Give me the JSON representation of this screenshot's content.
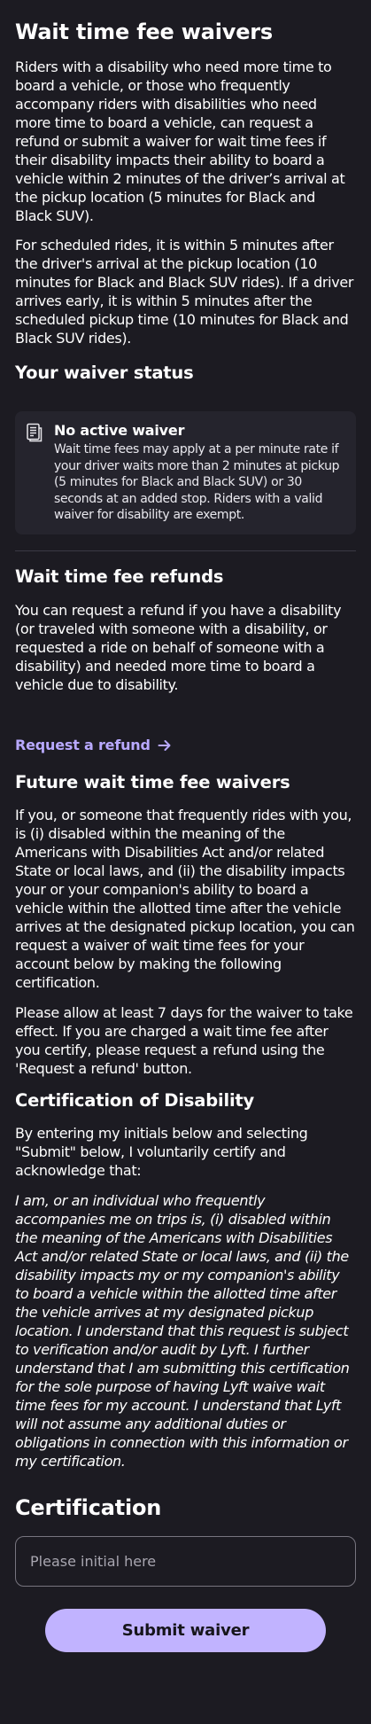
{
  "page_title": "Wait time fee waivers",
  "intro_paragraphs": [
    "Riders with a disability who need more time to board a vehicle, or those who frequently accompany riders with disabilities who need more time to board a vehicle, can request a refund or submit a waiver for wait time fees if their disability impacts their ability to board a vehicle within 2 minutes of the driver’s arrival at the pickup location (5 minutes for Black and Black SUV).",
    "For scheduled rides, it is within 5 minutes after the driver's arrival at the pickup location (10 minutes for Black and Black SUV rides). If a driver arrives early, it is within 5 minutes after the scheduled pickup time (10 minutes for Black and Black SUV rides)."
  ],
  "waiver_status": {
    "heading": "Your waiver status",
    "icon": "document-icon",
    "title": "No active waiver",
    "description": "Wait time fees may apply at a per minute rate if your driver waits more than 2 minutes at pickup (5 minutes for Black and Black SUV) or 30 seconds at an added stop. Riders with a valid waiver for disability are exempt."
  },
  "refunds": {
    "heading": "Wait time fee refunds",
    "text": "You can request a refund if you have a disability (or traveled with someone with a disability, or requested a ride on behalf of someone with a disability) and needed more time to board a vehicle due to disability.",
    "link_label": "Request a refund",
    "link_icon": "arrow-right-icon"
  },
  "future_waivers": {
    "heading": "Future wait time fee waivers",
    "paragraphs": [
      "If you, or someone that frequently rides with you, is (i) disabled within the meaning of the Americans with Disabilities Act and/or related State or local laws, and (ii) the disability impacts your or your companion's ability to board a vehicle within the allotted time after the vehicle arrives at the designated pickup location, you can request a waiver of wait time fees for your account below by making the following certification.",
      "Please allow at least 7 days for the waiver to take effect. If you are charged a wait time fee after you certify, please request a refund using the 'Request a refund' button."
    ]
  },
  "certification_of_disability": {
    "heading": "Certification of Disability",
    "intro": "By entering my initials below and selecting \"Submit\" below, I voluntarily certify and acknowledge that:",
    "statement": "I am, or an individual who frequently accompanies me on trips is, (i) disabled within the meaning of the Americans with Disabilities Act and/or related State or local laws, and (ii) the disability impacts my or my companion's ability to board a vehicle within the allotted time after the vehicle arrives at my designated pickup location. I understand that this request is subject to verification and/or audit by Lyft. I further understand that I am submitting this certification for the sole purpose of having Lyft waive wait time fees for my account. I understand that Lyft will not assume any additional duties or obligations in connection with this information or my certification."
  },
  "certification": {
    "heading": "Certification",
    "input_value": "",
    "input_placeholder": "Please initial here",
    "submit_label": "Submit waiver"
  },
  "colors": {
    "background": "#1c1b22",
    "card": "#25242d",
    "link": "#b8a9ff",
    "button": "#c1b3ff",
    "button_text": "#16151b"
  }
}
